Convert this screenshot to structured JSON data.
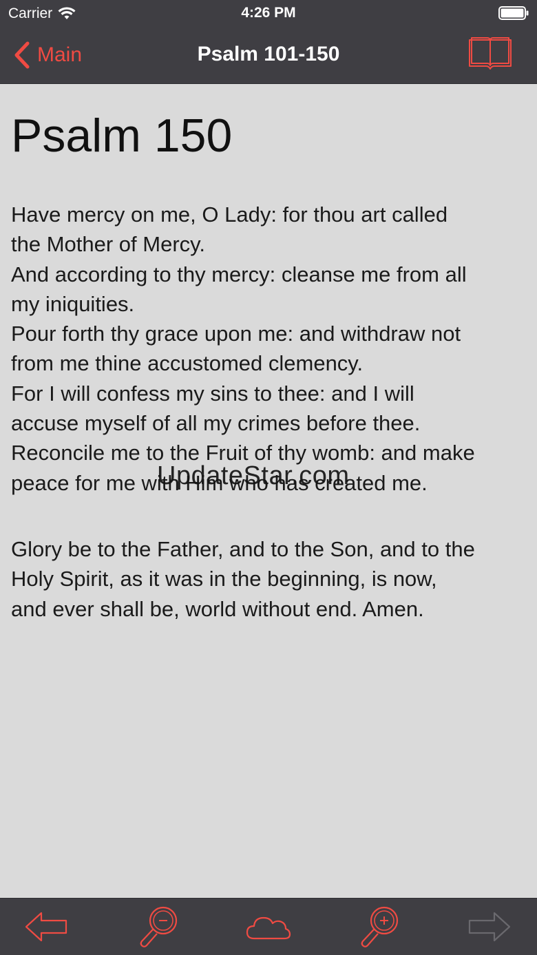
{
  "status_bar": {
    "carrier": "Carrier",
    "time": "4:26 PM"
  },
  "nav": {
    "back_label": "Main",
    "title": "Psalm 101-150"
  },
  "content": {
    "title": "Psalm 150",
    "verses": [
      "Have mercy on me, O Lady: for thou art called",
      "the Mother of Mercy.",
      "And according to thy mercy: cleanse me from all",
      "my iniquities.",
      "Pour forth thy grace upon me: and withdraw not",
      "from me thine accustomed clemency.",
      "For I will confess my sins to thee: and I will",
      "accuse myself of all my crimes before thee.",
      "Reconcile me to the Fruit of thy womb: and make",
      "peace for me with Him who has created me."
    ],
    "doxology": [
      "Glory be to the Father, and to the Son, and to the",
      "Holy Spirit, as it was in the beginning, is now,",
      "and ever shall be, world without end. Amen."
    ],
    "watermark": "UpdateStar.com"
  },
  "colors": {
    "accent": "#f04b43",
    "bar_background": "#3f3e43",
    "page_background": "#dadada",
    "disabled_icon": "#6a696e"
  },
  "icons": {
    "wifi": "wifi-icon",
    "battery": "battery-icon",
    "back": "chevron-left-icon",
    "book": "open-book-icon",
    "previous": "arrow-left-icon",
    "zoom_out": "zoom-out-icon",
    "cloud": "cloud-icon",
    "zoom_in": "zoom-in-icon",
    "next": "arrow-right-icon"
  }
}
